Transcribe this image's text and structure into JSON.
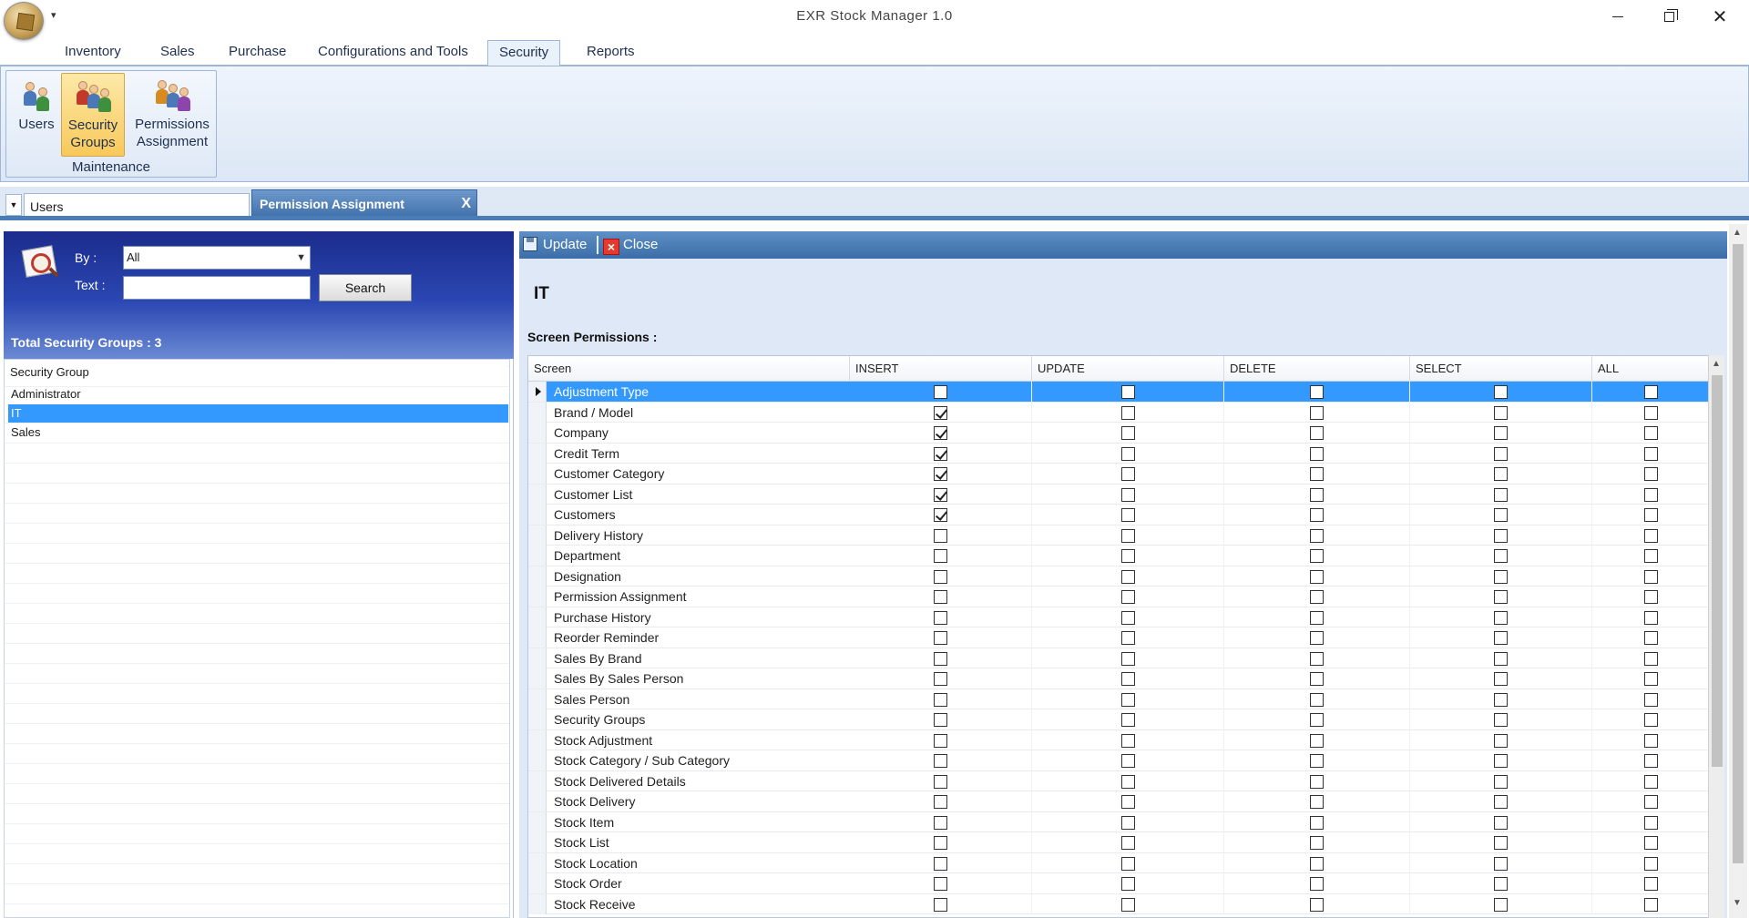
{
  "window": {
    "title": "EXR Stock Manager 1.0",
    "minimize": "minimize",
    "maximize": "restore",
    "close": "✕",
    "qat": "▾"
  },
  "ribbon": {
    "tabs": [
      "Inventory",
      "Sales",
      "Purchase",
      "Configurations and Tools",
      "Security",
      "Reports"
    ],
    "active_tab": "Security",
    "group_label": "Maintenance",
    "buttons": [
      {
        "label_1": "Users",
        "label_2": "",
        "icon": "users-icon"
      },
      {
        "label_1": "Security",
        "label_2": "Groups",
        "icon": "security-groups-icon"
      },
      {
        "label_1": "Permissions",
        "label_2": "Assignment",
        "icon": "permissions-assignment-icon"
      }
    ]
  },
  "doc_tabs": {
    "inactive": "Users",
    "active": "Permission Assignment",
    "close": "X",
    "dropdown": "▼"
  },
  "search": {
    "by_label": "By :",
    "by_value": "All",
    "text_label": "Text :",
    "text_value": "",
    "button": "Search",
    "total_label": "Total Security Groups : 3"
  },
  "group_list": {
    "header": "Security Group",
    "items": [
      "Administrator",
      "IT",
      "Sales"
    ],
    "selected": "IT"
  },
  "toolbar": {
    "update": "Update",
    "close": "Close"
  },
  "detail": {
    "group_name": "IT",
    "section_label": "Screen Permissions :"
  },
  "permissions": {
    "columns": [
      "Screen",
      "INSERT",
      "UPDATE",
      "DELETE",
      "SELECT",
      "ALL"
    ],
    "rows": [
      {
        "screen": "Adjustment Type",
        "insert": false,
        "update": false,
        "delete": false,
        "select": false,
        "all": false
      },
      {
        "screen": "Brand / Model",
        "insert": true,
        "update": false,
        "delete": false,
        "select": false,
        "all": false
      },
      {
        "screen": "Company",
        "insert": true,
        "update": false,
        "delete": false,
        "select": false,
        "all": false
      },
      {
        "screen": "Credit Term",
        "insert": true,
        "update": false,
        "delete": false,
        "select": false,
        "all": false
      },
      {
        "screen": "Customer Category",
        "insert": true,
        "update": false,
        "delete": false,
        "select": false,
        "all": false
      },
      {
        "screen": "Customer List",
        "insert": true,
        "update": false,
        "delete": false,
        "select": false,
        "all": false
      },
      {
        "screen": "Customers",
        "insert": true,
        "update": false,
        "delete": false,
        "select": false,
        "all": false
      },
      {
        "screen": "Delivery History",
        "insert": false,
        "update": false,
        "delete": false,
        "select": false,
        "all": false
      },
      {
        "screen": "Department",
        "insert": false,
        "update": false,
        "delete": false,
        "select": false,
        "all": false
      },
      {
        "screen": "Designation",
        "insert": false,
        "update": false,
        "delete": false,
        "select": false,
        "all": false
      },
      {
        "screen": "Permission Assignment",
        "insert": false,
        "update": false,
        "delete": false,
        "select": false,
        "all": false
      },
      {
        "screen": "Purchase History",
        "insert": false,
        "update": false,
        "delete": false,
        "select": false,
        "all": false
      },
      {
        "screen": "Reorder Reminder",
        "insert": false,
        "update": false,
        "delete": false,
        "select": false,
        "all": false
      },
      {
        "screen": "Sales By Brand",
        "insert": false,
        "update": false,
        "delete": false,
        "select": false,
        "all": false
      },
      {
        "screen": "Sales By Sales Person",
        "insert": false,
        "update": false,
        "delete": false,
        "select": false,
        "all": false
      },
      {
        "screen": "Sales Person",
        "insert": false,
        "update": false,
        "delete": false,
        "select": false,
        "all": false
      },
      {
        "screen": "Security Groups",
        "insert": false,
        "update": false,
        "delete": false,
        "select": false,
        "all": false
      },
      {
        "screen": "Stock Adjustment",
        "insert": false,
        "update": false,
        "delete": false,
        "select": false,
        "all": false
      },
      {
        "screen": "Stock Category / Sub Category",
        "insert": false,
        "update": false,
        "delete": false,
        "select": false,
        "all": false
      },
      {
        "screen": "Stock Delivered Details",
        "insert": false,
        "update": false,
        "delete": false,
        "select": false,
        "all": false
      },
      {
        "screen": "Stock Delivery",
        "insert": false,
        "update": false,
        "delete": false,
        "select": false,
        "all": false
      },
      {
        "screen": "Stock Item",
        "insert": false,
        "update": false,
        "delete": false,
        "select": false,
        "all": false
      },
      {
        "screen": "Stock List",
        "insert": false,
        "update": false,
        "delete": false,
        "select": false,
        "all": false
      },
      {
        "screen": "Stock Location",
        "insert": false,
        "update": false,
        "delete": false,
        "select": false,
        "all": false
      },
      {
        "screen": "Stock Order",
        "insert": false,
        "update": false,
        "delete": false,
        "select": false,
        "all": false
      },
      {
        "screen": "Stock Receive",
        "insert": false,
        "update": false,
        "delete": false,
        "select": false,
        "all": false
      }
    ],
    "selected_row": "Adjustment Type"
  },
  "colors": {
    "accent_blue": "#3399ff",
    "header_blue": "#2b47b3",
    "toolbar_blue": "#4a7cb6",
    "ribbon_active": "#f8c95a"
  }
}
